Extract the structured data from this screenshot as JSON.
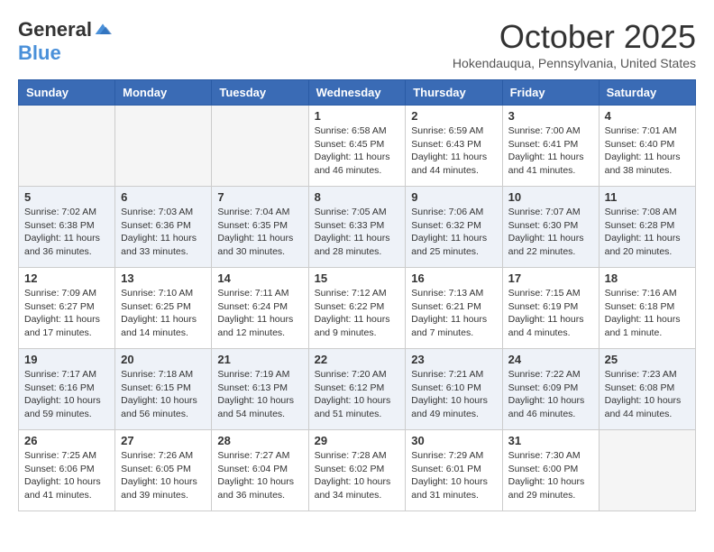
{
  "header": {
    "logo_general": "General",
    "logo_blue": "Blue",
    "month_title": "October 2025",
    "location": "Hokendauqua, Pennsylvania, United States"
  },
  "days_of_week": [
    "Sunday",
    "Monday",
    "Tuesday",
    "Wednesday",
    "Thursday",
    "Friday",
    "Saturday"
  ],
  "weeks": [
    [
      {
        "day": "",
        "info": ""
      },
      {
        "day": "",
        "info": ""
      },
      {
        "day": "",
        "info": ""
      },
      {
        "day": "1",
        "info": "Sunrise: 6:58 AM\nSunset: 6:45 PM\nDaylight: 11 hours\nand 46 minutes."
      },
      {
        "day": "2",
        "info": "Sunrise: 6:59 AM\nSunset: 6:43 PM\nDaylight: 11 hours\nand 44 minutes."
      },
      {
        "day": "3",
        "info": "Sunrise: 7:00 AM\nSunset: 6:41 PM\nDaylight: 11 hours\nand 41 minutes."
      },
      {
        "day": "4",
        "info": "Sunrise: 7:01 AM\nSunset: 6:40 PM\nDaylight: 11 hours\nand 38 minutes."
      }
    ],
    [
      {
        "day": "5",
        "info": "Sunrise: 7:02 AM\nSunset: 6:38 PM\nDaylight: 11 hours\nand 36 minutes."
      },
      {
        "day": "6",
        "info": "Sunrise: 7:03 AM\nSunset: 6:36 PM\nDaylight: 11 hours\nand 33 minutes."
      },
      {
        "day": "7",
        "info": "Sunrise: 7:04 AM\nSunset: 6:35 PM\nDaylight: 11 hours\nand 30 minutes."
      },
      {
        "day": "8",
        "info": "Sunrise: 7:05 AM\nSunset: 6:33 PM\nDaylight: 11 hours\nand 28 minutes."
      },
      {
        "day": "9",
        "info": "Sunrise: 7:06 AM\nSunset: 6:32 PM\nDaylight: 11 hours\nand 25 minutes."
      },
      {
        "day": "10",
        "info": "Sunrise: 7:07 AM\nSunset: 6:30 PM\nDaylight: 11 hours\nand 22 minutes."
      },
      {
        "day": "11",
        "info": "Sunrise: 7:08 AM\nSunset: 6:28 PM\nDaylight: 11 hours\nand 20 minutes."
      }
    ],
    [
      {
        "day": "12",
        "info": "Sunrise: 7:09 AM\nSunset: 6:27 PM\nDaylight: 11 hours\nand 17 minutes."
      },
      {
        "day": "13",
        "info": "Sunrise: 7:10 AM\nSunset: 6:25 PM\nDaylight: 11 hours\nand 14 minutes."
      },
      {
        "day": "14",
        "info": "Sunrise: 7:11 AM\nSunset: 6:24 PM\nDaylight: 11 hours\nand 12 minutes."
      },
      {
        "day": "15",
        "info": "Sunrise: 7:12 AM\nSunset: 6:22 PM\nDaylight: 11 hours\nand 9 minutes."
      },
      {
        "day": "16",
        "info": "Sunrise: 7:13 AM\nSunset: 6:21 PM\nDaylight: 11 hours\nand 7 minutes."
      },
      {
        "day": "17",
        "info": "Sunrise: 7:15 AM\nSunset: 6:19 PM\nDaylight: 11 hours\nand 4 minutes."
      },
      {
        "day": "18",
        "info": "Sunrise: 7:16 AM\nSunset: 6:18 PM\nDaylight: 11 hours\nand 1 minute."
      }
    ],
    [
      {
        "day": "19",
        "info": "Sunrise: 7:17 AM\nSunset: 6:16 PM\nDaylight: 10 hours\nand 59 minutes."
      },
      {
        "day": "20",
        "info": "Sunrise: 7:18 AM\nSunset: 6:15 PM\nDaylight: 10 hours\nand 56 minutes."
      },
      {
        "day": "21",
        "info": "Sunrise: 7:19 AM\nSunset: 6:13 PM\nDaylight: 10 hours\nand 54 minutes."
      },
      {
        "day": "22",
        "info": "Sunrise: 7:20 AM\nSunset: 6:12 PM\nDaylight: 10 hours\nand 51 minutes."
      },
      {
        "day": "23",
        "info": "Sunrise: 7:21 AM\nSunset: 6:10 PM\nDaylight: 10 hours\nand 49 minutes."
      },
      {
        "day": "24",
        "info": "Sunrise: 7:22 AM\nSunset: 6:09 PM\nDaylight: 10 hours\nand 46 minutes."
      },
      {
        "day": "25",
        "info": "Sunrise: 7:23 AM\nSunset: 6:08 PM\nDaylight: 10 hours\nand 44 minutes."
      }
    ],
    [
      {
        "day": "26",
        "info": "Sunrise: 7:25 AM\nSunset: 6:06 PM\nDaylight: 10 hours\nand 41 minutes."
      },
      {
        "day": "27",
        "info": "Sunrise: 7:26 AM\nSunset: 6:05 PM\nDaylight: 10 hours\nand 39 minutes."
      },
      {
        "day": "28",
        "info": "Sunrise: 7:27 AM\nSunset: 6:04 PM\nDaylight: 10 hours\nand 36 minutes."
      },
      {
        "day": "29",
        "info": "Sunrise: 7:28 AM\nSunset: 6:02 PM\nDaylight: 10 hours\nand 34 minutes."
      },
      {
        "day": "30",
        "info": "Sunrise: 7:29 AM\nSunset: 6:01 PM\nDaylight: 10 hours\nand 31 minutes."
      },
      {
        "day": "31",
        "info": "Sunrise: 7:30 AM\nSunset: 6:00 PM\nDaylight: 10 hours\nand 29 minutes."
      },
      {
        "day": "",
        "info": ""
      }
    ]
  ]
}
